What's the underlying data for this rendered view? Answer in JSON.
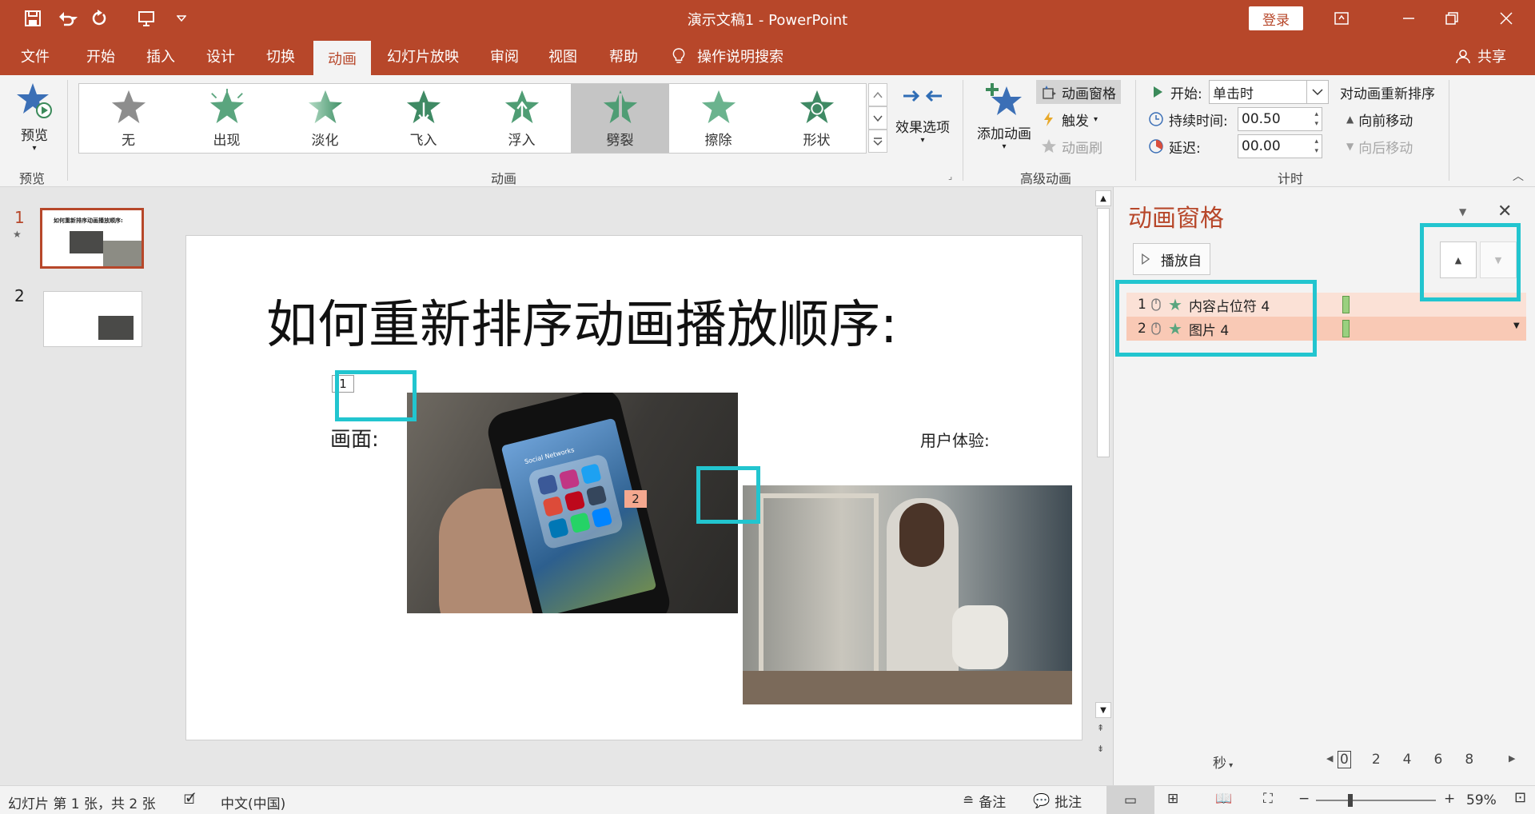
{
  "titlebar": {
    "doc_title": "演示文稿1  -  PowerPoint",
    "login_label": "登录"
  },
  "tabs": [
    "文件",
    "开始",
    "插入",
    "设计",
    "切换",
    "动画",
    "幻灯片放映",
    "审阅",
    "视图",
    "帮助",
    "操作说明搜索"
  ],
  "active_tab": "动画",
  "share_label": "共享",
  "ribbon": {
    "preview": {
      "button": "预览",
      "group": "预览"
    },
    "animation": {
      "effects": [
        "无",
        "出现",
        "淡化",
        "飞入",
        "浮入",
        "劈裂",
        "擦除",
        "形状"
      ],
      "selected": "劈裂",
      "effect_options": "效果选项",
      "group": "动画"
    },
    "advanced": {
      "add_animation": "添加动画",
      "animation_pane": "动画窗格",
      "trigger": "触发",
      "animation_painter": "动画刷",
      "group": "高级动画"
    },
    "timing": {
      "start_label": "开始:",
      "start_value": "单击时",
      "duration_label": "持续时间:",
      "duration_value": "00.50",
      "delay_label": "延迟:",
      "delay_value": "00.00",
      "reorder_title": "对动画重新排序",
      "move_earlier": "向前移动",
      "move_later": "向后移动",
      "group": "计时"
    }
  },
  "thumbnails": [
    {
      "num": "1",
      "title": "如何重新排序动画播放顺序:"
    },
    {
      "num": "2"
    }
  ],
  "slide": {
    "title": "如何重新排序动画播放顺序:",
    "label_left": "画面:",
    "label_right": "用户体验:",
    "tag1": "1",
    "tag2": "2",
    "phone_screen_text": "Social Networks"
  },
  "anim_pane": {
    "title": "动画窗格",
    "play_from": "播放自",
    "items": [
      {
        "num": "1",
        "name": "内容占位符 4"
      },
      {
        "num": "2",
        "name": "图片 4"
      }
    ],
    "seconds_label": "秒",
    "timeline_ticks": [
      "0",
      "2",
      "4",
      "6",
      "8"
    ]
  },
  "status": {
    "slide_info": "幻灯片 第 1 张，共 2 张",
    "language": "中文(中国)",
    "notes": "备注",
    "comments": "批注",
    "zoom": "59%"
  },
  "colors": {
    "accent": "#b7472a",
    "highlight": "#22c5cf",
    "star_green": "#5aa57e",
    "row_selected": "#f9c9b5"
  }
}
